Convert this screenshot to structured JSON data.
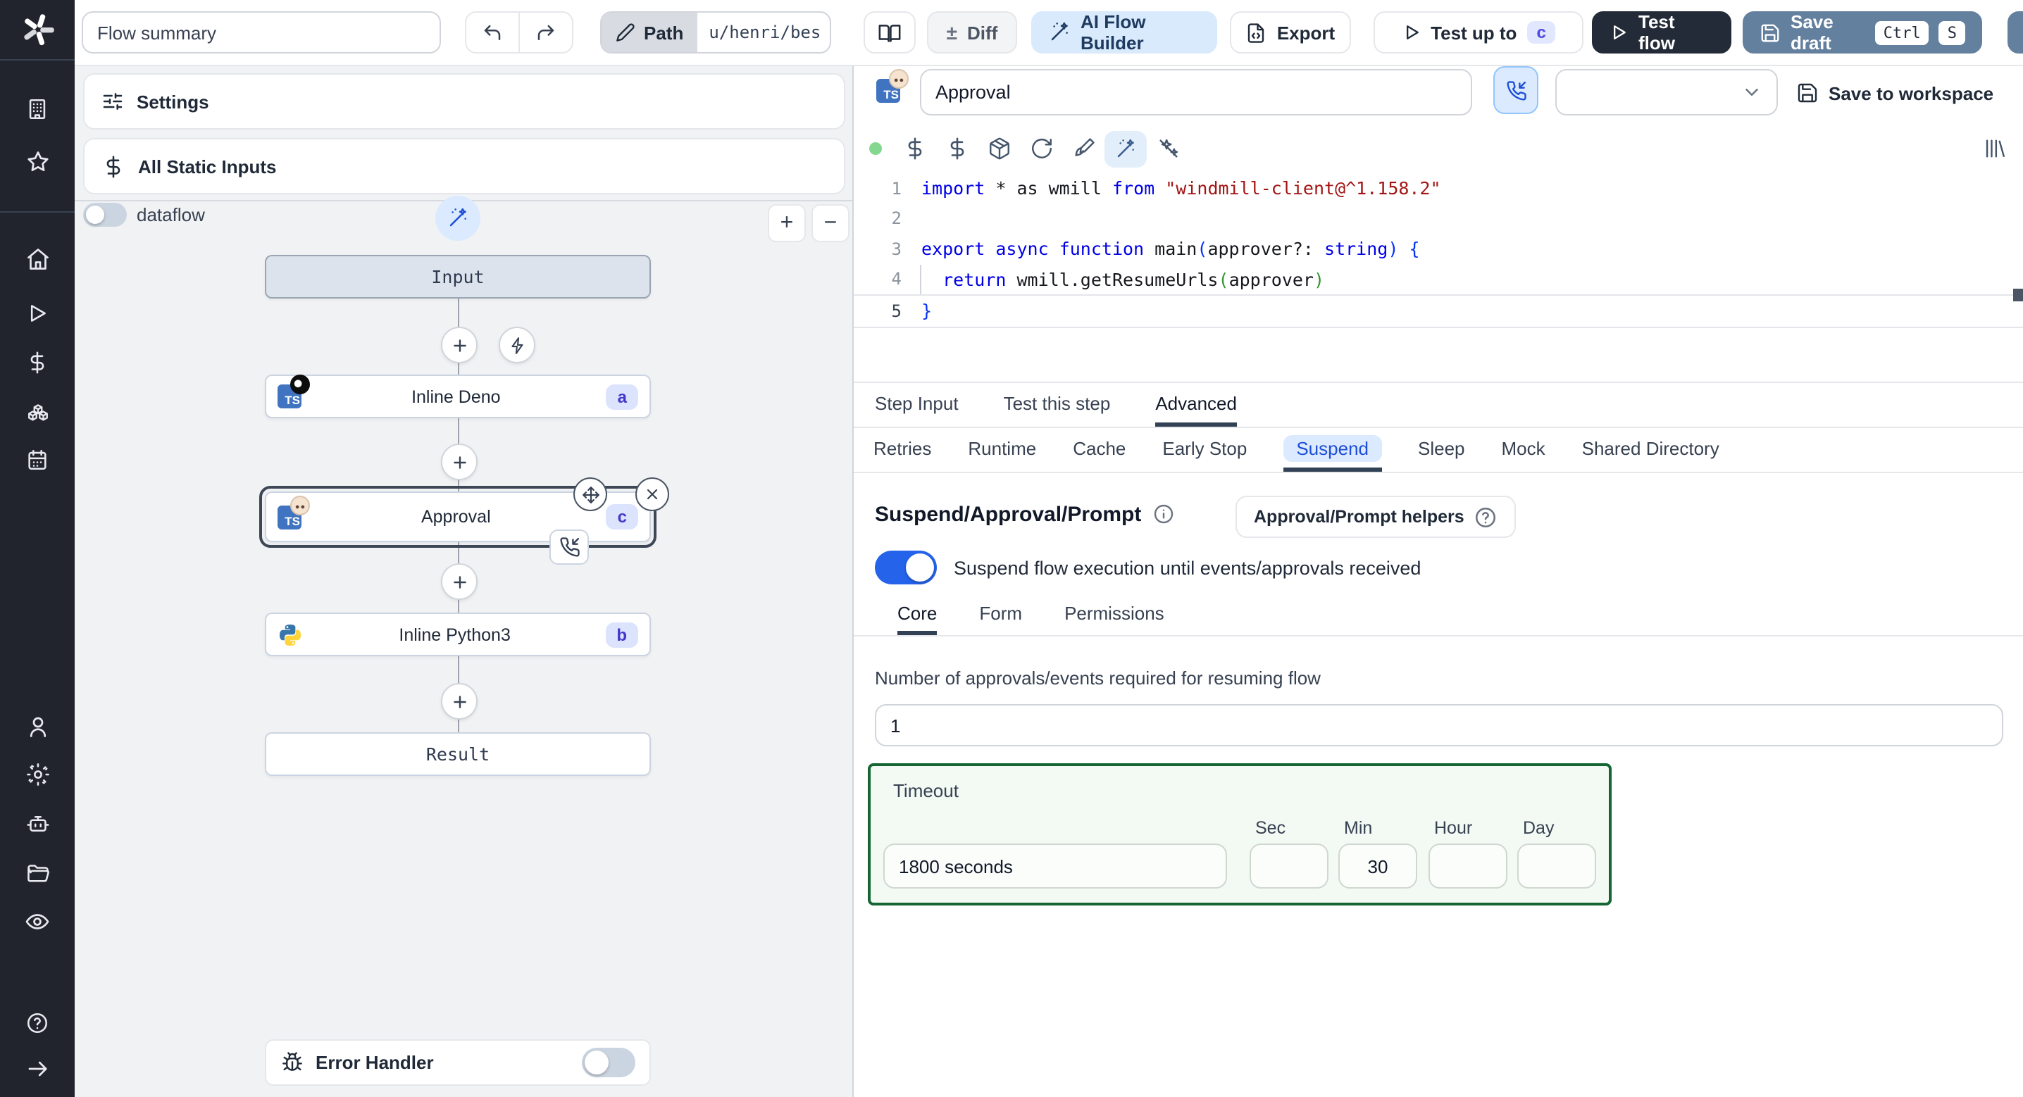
{
  "topbar": {
    "flow_summary": "Flow summary",
    "path_label": "Path",
    "path_value": "u/henri/bes",
    "diff_label": "Diff",
    "plus_minus": "±",
    "ai_flow_builder_label": "AI Flow Builder",
    "export_label": "Export",
    "test_up_to_label": "Test up to",
    "test_up_to_badge": "c",
    "test_flow_label": "Test flow",
    "save_draft_label": "Save draft",
    "kbd_ctrl": "Ctrl",
    "kbd_s": "S"
  },
  "rail": {
    "icons": [
      "windmill-logo",
      "building",
      "star",
      "home",
      "play",
      "dollar",
      "boxes",
      "calendar",
      "user",
      "gear",
      "robot",
      "folder",
      "eye",
      "help",
      "arrow-right"
    ]
  },
  "flow_panel": {
    "settings_label": "Settings",
    "static_inputs_label": "All Static Inputs",
    "dataflow_label": "dataflow",
    "dataflow_on": false,
    "zoom_in": "+",
    "zoom_out": "−",
    "nodes": {
      "input": {
        "label": "Input"
      },
      "deno": {
        "label": "Inline Deno",
        "badge": "a",
        "language": "typescript-deno"
      },
      "approval": {
        "label": "Approval",
        "badge": "c",
        "language": "typescript-bun",
        "selected": true
      },
      "python": {
        "label": "Inline Python3",
        "badge": "b",
        "language": "python3"
      },
      "result": {
        "label": "Result"
      }
    },
    "error_handler_label": "Error Handler",
    "error_handler_on": false
  },
  "editor": {
    "step_name": "Approval",
    "save_to_workspace_label": "Save to workspace",
    "toolbar_icons": [
      "status-dot",
      "dollar",
      "dollar",
      "package",
      "reload",
      "paintbrush",
      "wand-sparkles",
      "sparkles-off",
      "library"
    ],
    "code": {
      "lines": [
        {
          "n": "1",
          "segments": [
            {
              "t": "import ",
              "c": "kw"
            },
            {
              "t": "* as wmill ",
              "c": "pl"
            },
            {
              "t": "from ",
              "c": "kw"
            },
            {
              "t": "\"windmill-client@^1.158.2\"",
              "c": "str"
            }
          ]
        },
        {
          "n": "2",
          "segments": []
        },
        {
          "n": "3",
          "segments": [
            {
              "t": "export ",
              "c": "kw"
            },
            {
              "t": "async ",
              "c": "kw"
            },
            {
              "t": "function ",
              "c": "kw"
            },
            {
              "t": "main",
              "c": "pl"
            },
            {
              "t": "(",
              "c": "b1"
            },
            {
              "t": "approver?: ",
              "c": "pl"
            },
            {
              "t": "string",
              "c": "kw"
            },
            {
              "t": ") {",
              "c": "b1"
            }
          ]
        },
        {
          "n": "4",
          "segments": [
            {
              "t": "  ",
              "c": "pl"
            },
            {
              "t": "return ",
              "c": "kw"
            },
            {
              "t": "wmill.getResumeUrls",
              "c": "pl"
            },
            {
              "t": "(",
              "c": "b2"
            },
            {
              "t": "approver",
              "c": "pl"
            },
            {
              "t": ")",
              "c": "b2"
            }
          ]
        },
        {
          "n": "5",
          "segments": [
            {
              "t": "}",
              "c": "b1"
            }
          ]
        }
      ]
    },
    "step_tabs": [
      {
        "label": "Step Input"
      },
      {
        "label": "Test this step"
      },
      {
        "label": "Advanced",
        "active": true
      }
    ],
    "advanced_tabs": [
      {
        "label": "Retries"
      },
      {
        "label": "Runtime"
      },
      {
        "label": "Cache"
      },
      {
        "label": "Early Stop"
      },
      {
        "label": "Suspend",
        "active": true
      },
      {
        "label": "Sleep"
      },
      {
        "label": "Mock"
      },
      {
        "label": "Shared Directory"
      }
    ],
    "suspend": {
      "title": "Suspend/Approval/Prompt",
      "helpers_button_label": "Approval/Prompt helpers",
      "toggle_label": "Suspend flow execution until events/approvals received",
      "toggle_on": true,
      "sub_tabs": [
        {
          "label": "Core",
          "active": true
        },
        {
          "label": "Form"
        },
        {
          "label": "Permissions"
        }
      ],
      "approvals_label": "Number of approvals/events required for resuming flow",
      "approvals_value": "1",
      "timeout": {
        "label": "Timeout",
        "duration_value": "1800 seconds",
        "units": [
          {
            "label": "Sec",
            "value": ""
          },
          {
            "label": "Min",
            "value": "30"
          },
          {
            "label": "Hour",
            "value": ""
          },
          {
            "label": "Day",
            "value": ""
          }
        ]
      }
    }
  },
  "colors": {
    "accent_blue": "#2563eb",
    "ai_button_bg": "#d8eafc",
    "save_draft_bg": "#64809f",
    "test_flow_bg": "#242b38",
    "timeout_border_green": "#166534",
    "badge_bg": "#dbe3fd",
    "badge_text": "#4338ca",
    "rail_bg": "#21242c"
  }
}
